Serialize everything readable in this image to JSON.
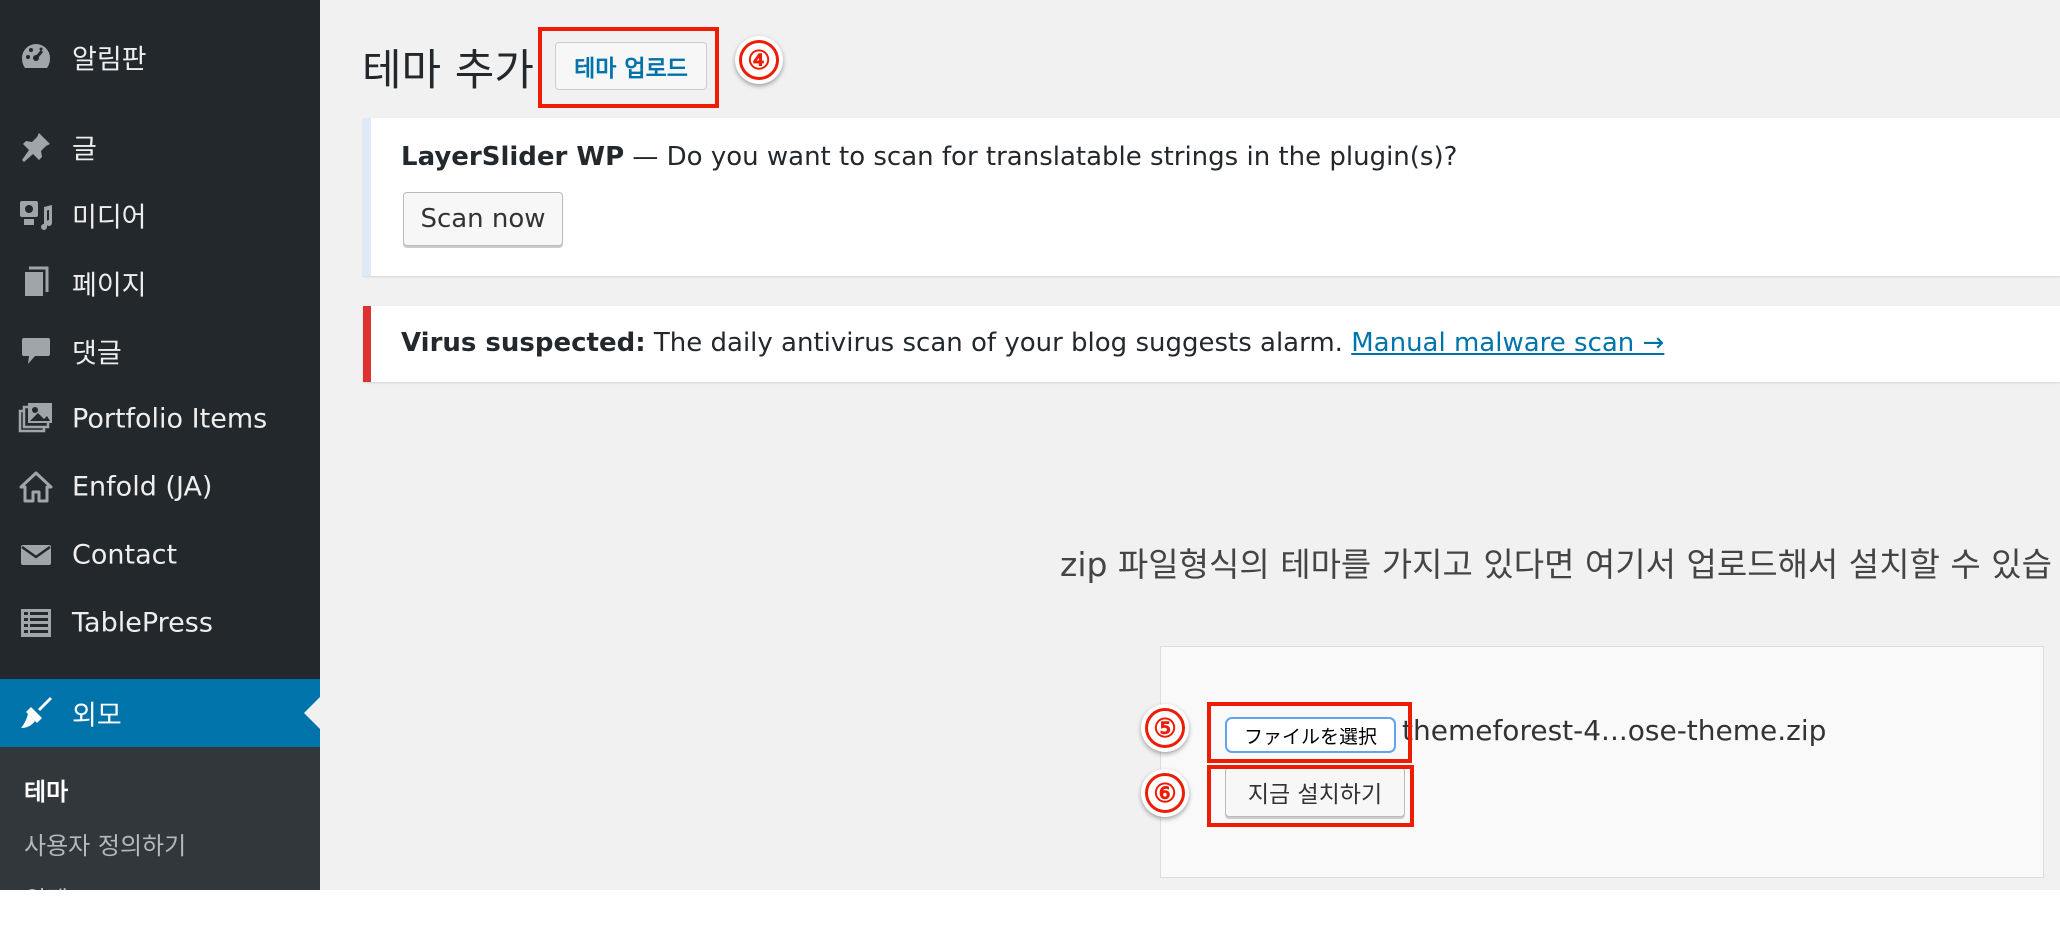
{
  "sidebar": {
    "items": [
      {
        "label": "알림판",
        "icon": "dashboard-icon"
      },
      {
        "label": "글",
        "icon": "pushpin-icon"
      },
      {
        "label": "미디어",
        "icon": "media-icon"
      },
      {
        "label": "페이지",
        "icon": "page-icon"
      },
      {
        "label": "댓글",
        "icon": "comment-icon"
      },
      {
        "label": "Portfolio Items",
        "icon": "portfolio-icon"
      },
      {
        "label": "Enfold (JA)",
        "icon": "home-icon"
      },
      {
        "label": "Contact",
        "icon": "envelope-icon"
      },
      {
        "label": "TablePress",
        "icon": "table-icon"
      },
      {
        "label": "외모",
        "icon": "paintbrush-icon",
        "active": true
      }
    ],
    "submenu": [
      {
        "label": "테마",
        "current": true
      },
      {
        "label": "사용자 정의하기"
      },
      {
        "label": "위젯"
      }
    ]
  },
  "header": {
    "title": "테마 추가",
    "upload_button": "테마 업로드"
  },
  "notices": {
    "layerslider": {
      "plugin": "LayerSlider WP",
      "message": " — Do you want to scan for translatable strings in the plugin(s)?",
      "button": "Scan now"
    },
    "virus": {
      "label": "Virus suspected:",
      "message": " The daily antivirus scan of your blog suggests alarm. ",
      "link": "Manual malware scan →"
    }
  },
  "upload": {
    "description": "zip 파일형식의 테마를 가지고 있다면 여기서 업로드해서 설치할 수 있습",
    "file_button": "ファイルを選択",
    "file_name": "themeforest-4...ose-theme.zip",
    "install_button": "지금 설치하기"
  },
  "annotations": {
    "step4": "④",
    "step5": "⑤",
    "step6": "⑥"
  },
  "colors": {
    "sidebar_bg": "#23282d",
    "active_bg": "#0073aa",
    "annotation_red": "#ee1c05",
    "link": "#0073aa"
  }
}
